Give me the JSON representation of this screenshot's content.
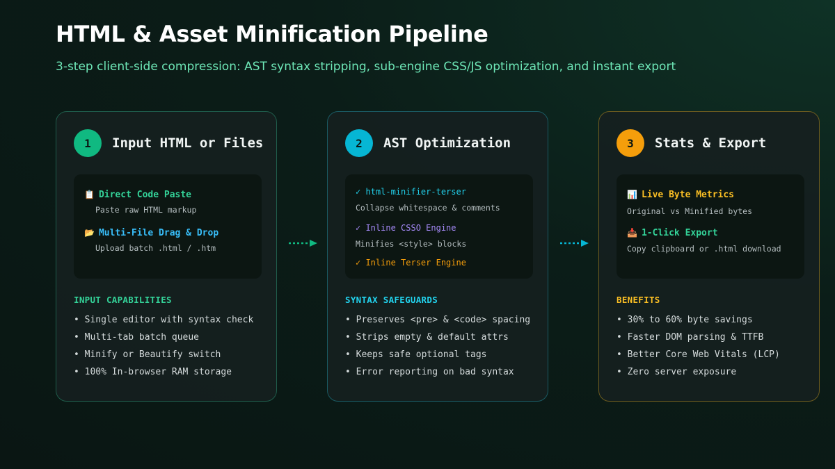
{
  "header": {
    "title": "HTML & Asset Minification Pipeline",
    "subtitle": "3-step client-side compression: AST syntax stripping, sub-engine CSS/JS optimization, and instant export"
  },
  "colors": {
    "step1": "#10b981",
    "step2": "#06b6d4",
    "step3": "#f59e0b",
    "background": "#0b1d18"
  },
  "steps": [
    {
      "number": "1",
      "title": "Input HTML or Files",
      "items": [
        {
          "icon": "clipboard-icon",
          "label": "Direct Code Paste",
          "sub": "Paste raw HTML markup"
        },
        {
          "icon": "folder-icon",
          "label": "Multi-File Drag & Drop",
          "sub": "Upload batch .html / .htm"
        }
      ],
      "section_title": "INPUT CAPABILITIES",
      "bullets": [
        "• Single editor with syntax check",
        "• Multi-tab batch queue",
        "• Minify or Beautify switch",
        "• 100% In-browser RAM storage"
      ]
    },
    {
      "number": "2",
      "title": "AST Optimization",
      "items": [
        {
          "label": "✓ html-minifier-terser",
          "sub": "Collapse whitespace & comments"
        },
        {
          "label": "✓ Inline CSSO Engine",
          "sub": "Minifies <style> blocks"
        },
        {
          "label": "✓ Inline Terser Engine",
          "sub": ""
        }
      ],
      "section_title": "SYNTAX SAFEGUARDS",
      "bullets": [
        "• Preserves <pre> & <code> spacing",
        "• Strips empty & default attrs",
        "• Keeps safe optional tags",
        "• Error reporting on bad syntax"
      ]
    },
    {
      "number": "3",
      "title": "Stats & Export",
      "items": [
        {
          "icon": "chart-icon",
          "label": "Live Byte Metrics",
          "sub": "Original vs Minified bytes"
        },
        {
          "icon": "download-icon",
          "label": "1-Click Export",
          "sub": "Copy clipboard or .html download"
        }
      ],
      "section_title": "BENEFITS",
      "bullets": [
        "• 30% to 60% byte savings",
        "• Faster DOM parsing & TTFB",
        "• Better Core Web Vitals (LCP)",
        "• Zero server exposure"
      ]
    }
  ]
}
